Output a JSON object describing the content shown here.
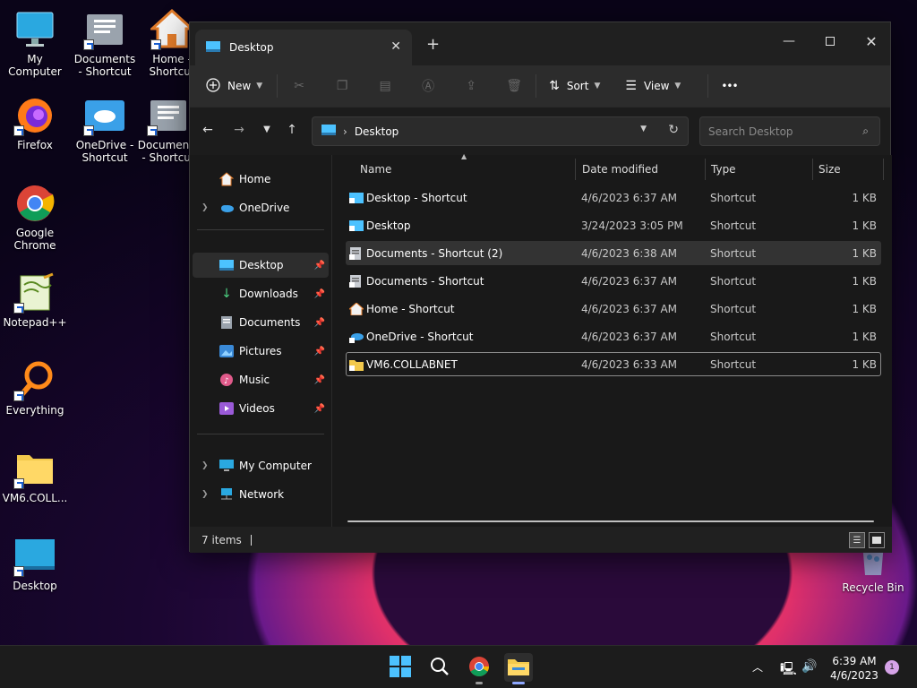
{
  "desktop": {
    "icons": [
      {
        "label": "My Computer"
      },
      {
        "label": "Documents - Shortcut"
      },
      {
        "label": "Home - Shortcut"
      },
      {
        "label": "Firefox"
      },
      {
        "label": "OneDrive - Shortcut"
      },
      {
        "label": "Documents - Shortcut"
      },
      {
        "label": "Google Chrome"
      },
      {
        "label": "Notepad++"
      },
      {
        "label": "Everything"
      },
      {
        "label": "VM6.COLL..."
      },
      {
        "label": "Desktop"
      },
      {
        "label": "Recycle Bin"
      }
    ]
  },
  "window": {
    "tab_title": "Desktop",
    "toolbar": {
      "new_label": "New",
      "sort_label": "Sort",
      "view_label": "View",
      "more_label": "•••"
    },
    "address": {
      "current": "Desktop"
    },
    "search": {
      "placeholder": "Search Desktop"
    },
    "nav": {
      "items": [
        {
          "label": "Home"
        },
        {
          "label": "OneDrive"
        },
        {
          "label": "Desktop"
        },
        {
          "label": "Downloads"
        },
        {
          "label": "Documents"
        },
        {
          "label": "Pictures"
        },
        {
          "label": "Music"
        },
        {
          "label": "Videos"
        },
        {
          "label": "My Computer"
        },
        {
          "label": "Network"
        }
      ]
    },
    "columns": {
      "name": "Name",
      "date": "Date modified",
      "type": "Type",
      "size": "Size"
    },
    "files": [
      {
        "name": "Desktop - Shortcut",
        "date": "4/6/2023 6:37 AM",
        "type": "Shortcut",
        "size": "1 KB"
      },
      {
        "name": "Desktop",
        "date": "3/24/2023 3:05 PM",
        "type": "Shortcut",
        "size": "1 KB"
      },
      {
        "name": "Documents - Shortcut (2)",
        "date": "4/6/2023 6:38 AM",
        "type": "Shortcut",
        "size": "1 KB"
      },
      {
        "name": "Documents - Shortcut",
        "date": "4/6/2023 6:37 AM",
        "type": "Shortcut",
        "size": "1 KB"
      },
      {
        "name": "Home - Shortcut",
        "date": "4/6/2023 6:37 AM",
        "type": "Shortcut",
        "size": "1 KB"
      },
      {
        "name": "OneDrive - Shortcut",
        "date": "4/6/2023 6:37 AM",
        "type": "Shortcut",
        "size": "1 KB"
      },
      {
        "name": "VM6.COLLABNET",
        "date": "4/6/2023 6:33 AM",
        "type": "Shortcut",
        "size": "1 KB"
      }
    ],
    "status": {
      "item_count": "7 items"
    }
  },
  "taskbar": {
    "clock_time": "6:39 AM",
    "clock_date": "4/6/2023",
    "notification_count": "1"
  },
  "colors": {
    "accent": "#4cc2ff",
    "window_bg": "#202020",
    "taskbar_bg": "#1c1c1c"
  }
}
